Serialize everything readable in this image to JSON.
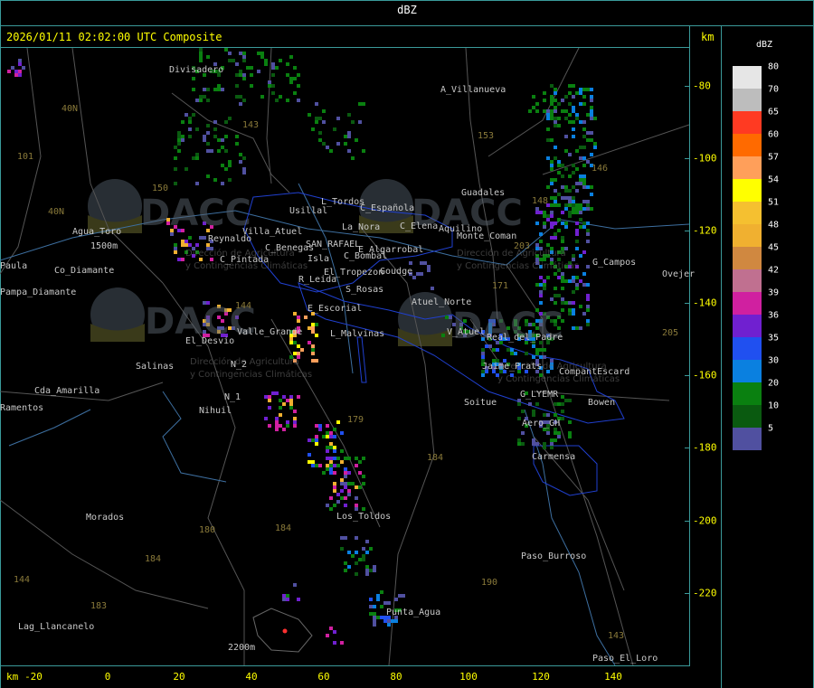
{
  "header": {
    "title": "dBZ"
  },
  "map_header": {
    "timestamp": "2026/01/11 02:02:00 UTC Composite",
    "unit_top": "km",
    "unit_bottom": "km"
  },
  "x_axis": {
    "ticks": [
      "-20",
      "0",
      "20",
      "40",
      "60",
      "80",
      "100",
      "120",
      "140"
    ]
  },
  "y_axis": {
    "ticks": [
      "-80",
      "-100",
      "-120",
      "-140",
      "-160",
      "-180",
      "-200",
      "-220"
    ]
  },
  "legend": {
    "unit": "dBZ",
    "entries": [
      {
        "label": "80",
        "color": "#e6e6e6"
      },
      {
        "label": "70",
        "color": "#bdbdbd"
      },
      {
        "label": "65",
        "color": "#ff3a22"
      },
      {
        "label": "60",
        "color": "#ff6a00"
      },
      {
        "label": "57",
        "color": "#ff9f5a"
      },
      {
        "label": "54",
        "color": "#ffff00"
      },
      {
        "label": "51",
        "color": "#f5c030"
      },
      {
        "label": "48",
        "color": "#f0b030"
      },
      {
        "label": "45",
        "color": "#d08840"
      },
      {
        "label": "42",
        "color": "#c07090"
      },
      {
        "label": "39",
        "color": "#d020a0"
      },
      {
        "label": "36",
        "color": "#7020d0"
      },
      {
        "label": "35",
        "color": "#2050f0"
      },
      {
        "label": "30",
        "color": "#0a80e0"
      },
      {
        "label": "20",
        "color": "#0a8010"
      },
      {
        "label": "10",
        "color": "#0a5a10"
      },
      {
        "label": "5",
        "color": "#5050a0"
      }
    ]
  },
  "watermark": {
    "logo": "DACC",
    "line1": "Dirección de Agricultura",
    "line2": "y Contingencias Climáticas"
  },
  "places": [
    {
      "name": "Divisadero"
    },
    {
      "name": "A_Villanueva"
    },
    {
      "name": "Guadales"
    },
    {
      "name": "Agua_Toro"
    },
    {
      "name": "1500m"
    },
    {
      "name": "Paula"
    },
    {
      "name": "Co_Diamante"
    },
    {
      "name": "Pampa_Diamante"
    },
    {
      "name": "Reynaldo"
    },
    {
      "name": "Villa_Atuel"
    },
    {
      "name": "L_Tordos"
    },
    {
      "name": "Usillal"
    },
    {
      "name": "C_Española"
    },
    {
      "name": "La_Nora"
    },
    {
      "name": "C_Elena"
    },
    {
      "name": "C_Benegas"
    },
    {
      "name": "SAN_RAFAEL"
    },
    {
      "name": "E_Algarrobal"
    },
    {
      "name": "C_Pintada"
    },
    {
      "name": "Isla"
    },
    {
      "name": "C_Bombal"
    },
    {
      "name": "El_Tropezon"
    },
    {
      "name": "Goudge"
    },
    {
      "name": "R_Leida"
    },
    {
      "name": "S_Rosas"
    },
    {
      "name": "Atuel_Norte"
    },
    {
      "name": "E_Escorial"
    },
    {
      "name": "Monte_Coman"
    },
    {
      "name": "G_Campos"
    },
    {
      "name": "El_Desvio"
    },
    {
      "name": "Valle_Grande"
    },
    {
      "name": "L_Malvinas"
    },
    {
      "name": "V_Atuel"
    },
    {
      "name": "Real_del_Padre"
    },
    {
      "name": "Salinas"
    },
    {
      "name": "N_2"
    },
    {
      "name": "N_1"
    },
    {
      "name": "Jaime_Prats"
    },
    {
      "name": "CompantEscard"
    },
    {
      "name": "Cda_Amarilla"
    },
    {
      "name": "Ramentos"
    },
    {
      "name": "Nihuil"
    },
    {
      "name": "Soitue"
    },
    {
      "name": "G_LYEMR"
    },
    {
      "name": "Bowen"
    },
    {
      "name": "Aero_GH"
    },
    {
      "name": "Carmensa"
    },
    {
      "name": "Morados"
    },
    {
      "name": "Los_Toldos"
    },
    {
      "name": "Paso_Burroso"
    },
    {
      "name": "Lag_Llancanelo"
    },
    {
      "name": "Punta_Agua"
    },
    {
      "name": "Paso_El_Loro"
    },
    {
      "name": "Ovejer"
    },
    {
      "name": "2200m"
    },
    {
      "name": "Aquilino"
    }
  ],
  "routes": [
    {
      "name": "40N"
    },
    {
      "name": "101"
    },
    {
      "name": "40N"
    },
    {
      "name": "150"
    },
    {
      "name": "143"
    },
    {
      "name": "153"
    },
    {
      "name": "146"
    },
    {
      "name": "148"
    },
    {
      "name": "203"
    },
    {
      "name": "171"
    },
    {
      "name": "144"
    },
    {
      "name": "179"
    },
    {
      "name": "184"
    },
    {
      "name": "180"
    },
    {
      "name": "184"
    },
    {
      "name": "184"
    },
    {
      "name": "183"
    },
    {
      "name": "190"
    },
    {
      "name": "143"
    },
    {
      "name": "205"
    },
    {
      "name": "144"
    }
  ]
}
